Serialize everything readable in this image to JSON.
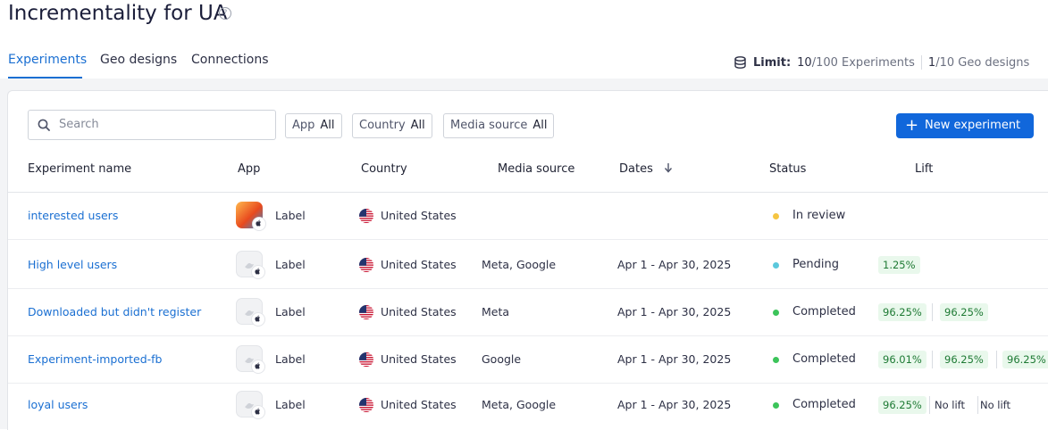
{
  "page": {
    "title": "Incrementality for UA"
  },
  "tabs": [
    {
      "label": "Experiments",
      "active": true
    },
    {
      "label": "Geo designs",
      "active": false
    },
    {
      "label": "Connections",
      "active": false
    }
  ],
  "limit": {
    "label": "Limit:",
    "experiments_used": "10",
    "experiments_text": "/100 Experiments",
    "geo_used": "1",
    "geo_text": "/10 Geo designs",
    "icon": "database-icon"
  },
  "toolbar": {
    "search_placeholder": "Search",
    "filters": [
      {
        "label": "App",
        "value": "All"
      },
      {
        "label": "Country",
        "value": "All"
      },
      {
        "label": "Media source",
        "value": "All"
      }
    ],
    "new_button": "New experiment"
  },
  "table": {
    "headers": [
      "Experiment name",
      "App",
      "Country",
      "Media source",
      "Dates",
      "Status",
      "Lift"
    ],
    "sort_icon": "arrow-down-icon",
    "rows": [
      {
        "name": "interested users",
        "app_label": "Label",
        "country": "United States",
        "media": "",
        "dates": "",
        "status": "In review",
        "status_color": "#f5c542",
        "lift": []
      },
      {
        "name": "High level users",
        "app_label": "Label",
        "country": "United States",
        "media": "Meta, Google",
        "dates": "Apr 1 - Apr 30, 2025",
        "status": "Pending",
        "status_color": "#5bc8dc",
        "lift": [
          "1.25%"
        ]
      },
      {
        "name": "Downloaded but didn't register",
        "app_label": "Label",
        "country": "United States",
        "media": "Meta",
        "dates": "Apr 1 - Apr 30, 2025",
        "status": "Completed",
        "status_color": "#3cc45a",
        "lift": [
          "96.25%",
          "96.25%"
        ]
      },
      {
        "name": "Experiment-imported-fb",
        "app_label": "Label",
        "country": "United States",
        "media": "Google",
        "dates": "Apr 1 - Apr 30, 2025",
        "status": "Completed",
        "status_color": "#3cc45a",
        "lift": [
          "96.01%",
          "96.25%",
          "96.25%"
        ]
      },
      {
        "name": "loyal users",
        "app_label": "Label",
        "country": "United States",
        "media": "Meta, Google",
        "dates": "Apr 1 - Apr 30, 2025",
        "status": "Completed",
        "status_color": "#3cc45a",
        "lift": [
          "96.25%",
          "No lift",
          "No lift"
        ]
      }
    ]
  }
}
